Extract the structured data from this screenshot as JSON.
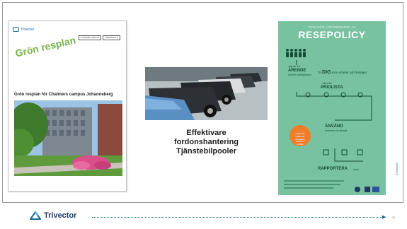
{
  "left_document": {
    "logo_text": "Trivector",
    "header_boxes": [
      "RAPPORT 2014:37",
      "VERSION 1.0"
    ],
    "stamp": "Grön resplan",
    "title": "Grön resplan för Chalmers campus Johanneberg"
  },
  "middle": {
    "lines": [
      "Effektivare",
      "fordonshantering",
      "Tjänstebilpooler"
    ]
  },
  "poster": {
    "tip": "TIPS FÖR UTFORMNING AV",
    "title": "RESEPOLICY",
    "dig_prefix": "Ta",
    "dig_bold": "DIG",
    "dig_suffix": "som arbetar på företaget",
    "arende_small": "Jag har ett",
    "arende": "ÄRENDE",
    "arende_sub": "utanför arbetsplatsen",
    "priolista_small": "Välj efter",
    "priolista": "PRIOLISTA",
    "anvand": "ANVÄND",
    "anvand_sub": "fordonen på rätt sätt",
    "rapportera": "RAPPORTERA",
    "rapportera_sub": "resor",
    "circle_text": [
      "Avstå från",
      "miljöresor",
      "företagets",
      "hyrbil om",
      "möjligt"
    ],
    "colors": {
      "background": "#78c2a0",
      "accent": "#f07d2a",
      "dark": "#134d35"
    }
  },
  "side_mark": "©Trivector",
  "footer": {
    "logo_text": "Trivector",
    "page_number": "11"
  }
}
